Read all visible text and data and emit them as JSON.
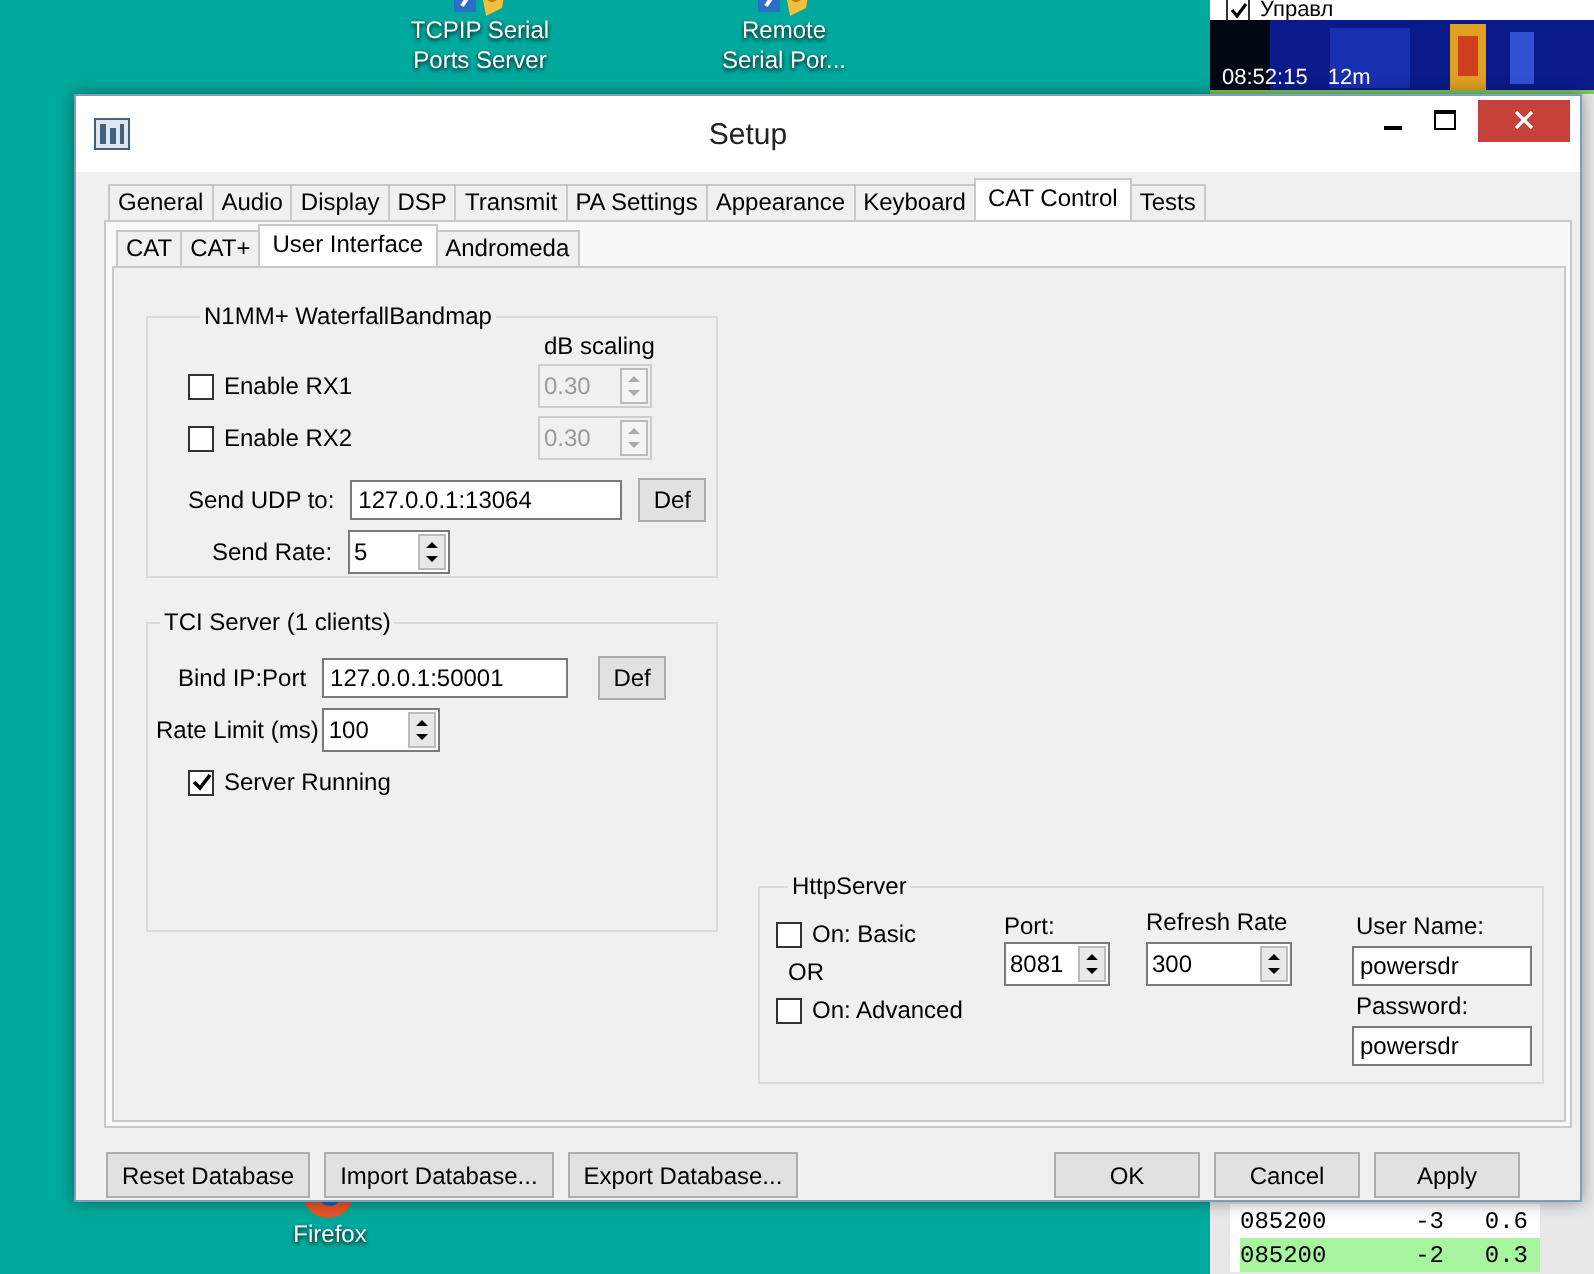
{
  "desktop": {
    "icons": [
      {
        "label": "TCPIP Serial Ports Server"
      },
      {
        "label": "Remote Serial Por..."
      },
      {
        "label": "Firefox"
      }
    ]
  },
  "background_window": {
    "checkbox": {
      "label": "Управл",
      "checked": true
    },
    "waterfall": {
      "time": "08:52:15",
      "band": "12m"
    },
    "rows": [
      {
        "cells": [
          "085200",
          "-3",
          "0.6"
        ],
        "selected": false
      },
      {
        "cells": [
          "085200",
          "-2",
          "0.3"
        ],
        "selected": true
      }
    ]
  },
  "window": {
    "title": "Setup"
  },
  "tabs": [
    {
      "label": "General",
      "selected": false
    },
    {
      "label": "Audio",
      "selected": false
    },
    {
      "label": "Display",
      "selected": false
    },
    {
      "label": "DSP",
      "selected": false
    },
    {
      "label": "Transmit",
      "selected": false
    },
    {
      "label": "PA Settings",
      "selected": false
    },
    {
      "label": "Appearance",
      "selected": false
    },
    {
      "label": "Keyboard",
      "selected": false
    },
    {
      "label": "CAT Control",
      "selected": true
    },
    {
      "label": "Tests",
      "selected": false
    }
  ],
  "subtabs": [
    {
      "label": "CAT",
      "selected": false
    },
    {
      "label": "CAT+",
      "selected": false
    },
    {
      "label": "User Interface",
      "selected": true
    },
    {
      "label": "Andromeda",
      "selected": false
    }
  ],
  "waterfall_bandmap": {
    "title": "N1MM+ WaterfallBandmap",
    "scaling_label": "dB scaling",
    "receivers": [
      {
        "label": "Enable RX1",
        "checked": false,
        "scaling": "0.30",
        "disabled": true
      },
      {
        "label": "Enable RX2",
        "checked": false,
        "scaling": "0.30",
        "disabled": true
      }
    ],
    "udp": {
      "label": "Send UDP to:",
      "value": "127.0.0.1:13064",
      "button": "Def"
    },
    "rate": {
      "label": "Send Rate:",
      "value": "5"
    }
  },
  "tci_server": {
    "title": "TCI Server (1 clients)",
    "bind": {
      "label": "Bind IP:Port",
      "value": "127.0.0.1:50001",
      "button": "Def"
    },
    "rate_limit": {
      "label": "Rate Limit (ms)",
      "value": "100"
    },
    "running": {
      "label": "Server Running",
      "checked": true
    }
  },
  "http_server": {
    "title": "HttpServer",
    "basic": {
      "label": "On: Basic",
      "checked": false
    },
    "or": "OR",
    "advanced": {
      "label": "On: Advanced",
      "checked": false
    },
    "port": {
      "label": "Port:",
      "value": "8081"
    },
    "refresh": {
      "label": "Refresh Rate",
      "value": "300"
    },
    "username": {
      "label": "User Name:",
      "value": "powersdr"
    },
    "password": {
      "label": "Password:",
      "value": "powersdr"
    }
  },
  "footer": {
    "left": [
      "Reset Database",
      "Import Database...",
      "Export Database..."
    ],
    "right": [
      "OK",
      "Cancel",
      "Apply"
    ]
  }
}
